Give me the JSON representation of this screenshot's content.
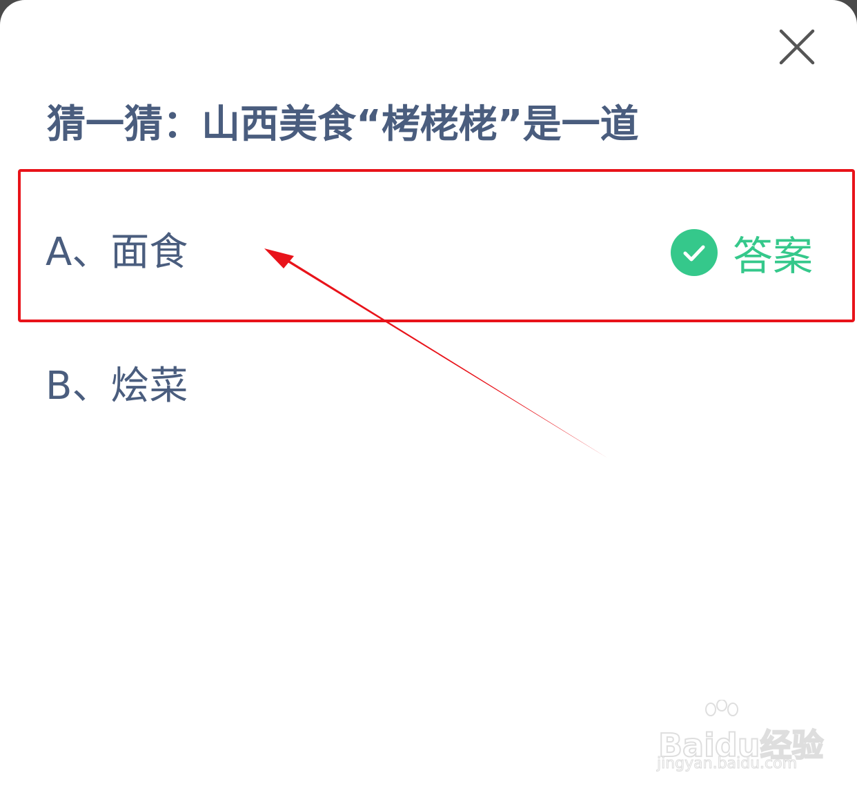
{
  "question": {
    "text": "猜一猜：山西美食“栲栳栳”是一道"
  },
  "options": [
    {
      "label": "A、面食",
      "is_answer": true
    },
    {
      "label": "B、烩菜",
      "is_answer": false
    }
  ],
  "answer_tag": {
    "text": "答案",
    "icon": "check-circle-icon",
    "color": "#35c88b"
  },
  "close_icon": "close-icon",
  "annotation": {
    "box_color": "#e8131a",
    "arrow_color": "#e8131a"
  },
  "watermark": {
    "logo": "Baidu经验",
    "url": "jingyan.baidu.com"
  },
  "colors": {
    "text": "#4a5d7e",
    "accent_green": "#35c88b",
    "annotation_red": "#e8131a"
  }
}
